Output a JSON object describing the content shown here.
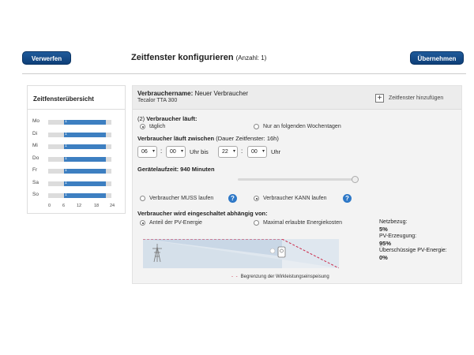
{
  "header": {
    "discard_label": "Verwerfen",
    "apply_label": "Übernehmen",
    "title": "Zeitfenster konfigurieren",
    "count": "(Anzahl: 1)"
  },
  "overview": {
    "title": "Zeitfensterübersicht",
    "days": [
      {
        "label": "Mo",
        "num": "1",
        "from_hour": 6,
        "to_hour": 22
      },
      {
        "label": "Di",
        "num": "1",
        "from_hour": 6,
        "to_hour": 22
      },
      {
        "label": "Mi",
        "num": "1",
        "from_hour": 6,
        "to_hour": 22
      },
      {
        "label": "Do",
        "num": "1",
        "from_hour": 6,
        "to_hour": 22
      },
      {
        "label": "Fr",
        "num": "1",
        "from_hour": 6,
        "to_hour": 22
      },
      {
        "label": "Sa",
        "num": "1",
        "from_hour": 6,
        "to_hour": 22
      },
      {
        "label": "So",
        "num": "1",
        "from_hour": 6,
        "to_hour": 22
      }
    ],
    "axis": [
      "0",
      "6",
      "12",
      "18",
      "24"
    ]
  },
  "consumer": {
    "name_label": "Verbrauchername:",
    "name_value": "Neuer Verbraucher",
    "model": "Tecalor TTA 300",
    "add_window_label": "Zeitfenster hinzufügen"
  },
  "runs": {
    "prefix": "(2)",
    "heading": "Verbraucher läuft:",
    "opt_daily": "täglich",
    "opt_weekdays": "Nur an folgenden Wochentagen",
    "selected": "daily"
  },
  "between": {
    "heading": "Verbraucher läuft zwischen",
    "duration": "(Dauer Zeitfenster: 16h)",
    "from_h": "06",
    "from_m": "00",
    "to_h": "22",
    "to_m": "00",
    "label_mid": "Uhr bis",
    "label_end": "Uhr"
  },
  "runtime": {
    "label": "Gerätelaufzeit: 940 Minuten",
    "slider_fraction": 1.0
  },
  "must_can": {
    "opt_must": "Verbraucher MUSS laufen",
    "opt_can": "Verbraucher KANN laufen",
    "selected": "can"
  },
  "depends": {
    "heading": "Verbraucher wird eingeschaltet abhängig von:",
    "opt_pv": "Anteil der PV-Energie",
    "opt_cost": "Maximal erlaubte Energiekosten",
    "selected": "pv",
    "legend": "Begrenzung der Wirkleistungseinspeisung"
  },
  "stats": {
    "grid_label": "Netzbezug:",
    "grid_value": "5%",
    "pv_label": "PV-Erzeugung:",
    "pv_value": "95%",
    "surplus_label": "Überschüssige PV-Energie:",
    "surplus_value": "0%"
  },
  "colors": {
    "accent": "#1f5a9a",
    "bar": "#3d7fc1",
    "limit_line": "#cc2a4a"
  }
}
